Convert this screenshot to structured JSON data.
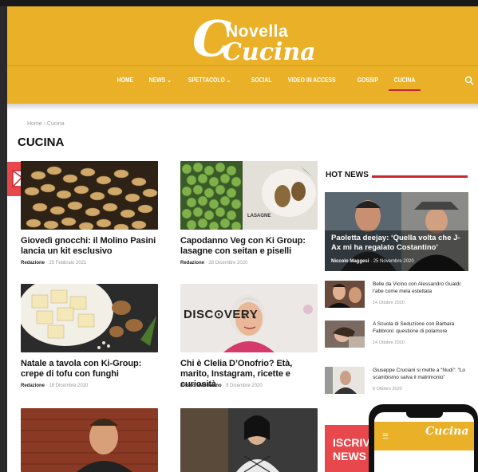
{
  "brand": {
    "logo_top": "Novella",
    "logo_main": "Cucina"
  },
  "nav": {
    "items": [
      {
        "label": "HOME"
      },
      {
        "label": "NEWS ⌄"
      },
      {
        "label": "SPETTACOLO ⌄"
      },
      {
        "label": "SOCIAL"
      },
      {
        "label": "VIDEO IN ACCESS"
      },
      {
        "label": "GOSSIP"
      },
      {
        "label": "CUCINA",
        "active": true
      }
    ]
  },
  "breadcrumb": "Home › Cucina",
  "page_title": "CUCINA",
  "articles": [
    {
      "title": "Giovedì gnocchi: il Molino Pasini lancia un kit esclusivo",
      "author": "Redazione",
      "date": "25 Febbraio 2021"
    },
    {
      "title": "Capodanno Veg con Ki Group: lasagne con seitan e piselli",
      "author": "Redazione",
      "date": "28 Dicembre 2020"
    },
    {
      "title": "Natale a tavola con Ki-Group: crepe di tofu con funghi",
      "author": "Redazione",
      "date": "18 Dicembre 2020"
    },
    {
      "title": "Chi è Clelia D’Onofrio? Età, marito, Instagram, ricette e curiosità",
      "author": "Enrico Maddaleno",
      "date": "9 Dicembre 2020"
    }
  ],
  "thumb_labels": {
    "lasagne": "LASAGNE",
    "discovery": "DISC⊙VERY"
  },
  "hot_news": {
    "heading": "HOT NEWS",
    "feature": {
      "title": "Paoletta deejay: ‘Quella volta che J-Ax mi ha regalato Costantino’",
      "author": "Niccolo Maggesi",
      "date": "25 Novembre 2020"
    },
    "items": [
      {
        "title": "Belle da Vicino con Alessandro Gualdi: l’abe come mela estettata",
        "date": "14 Ottobre 2020"
      },
      {
        "title": "A Scuola di Seduzione con Barbara Fabbroni: questione di polamore",
        "date": "14 Ottobre 2020"
      },
      {
        "title": "Giuseppe Cruciani si mette a “Nudi”: “Lo scambismo salva il matrimonio”",
        "date": "6 Ottobre 2020"
      }
    ]
  },
  "promo": {
    "line1": "ISCRIVI",
    "line2": "NEWS"
  },
  "colors": {
    "brand_yellow": "#e9b028",
    "accent_red": "#c8282e",
    "mail_red": "#e8484c"
  }
}
